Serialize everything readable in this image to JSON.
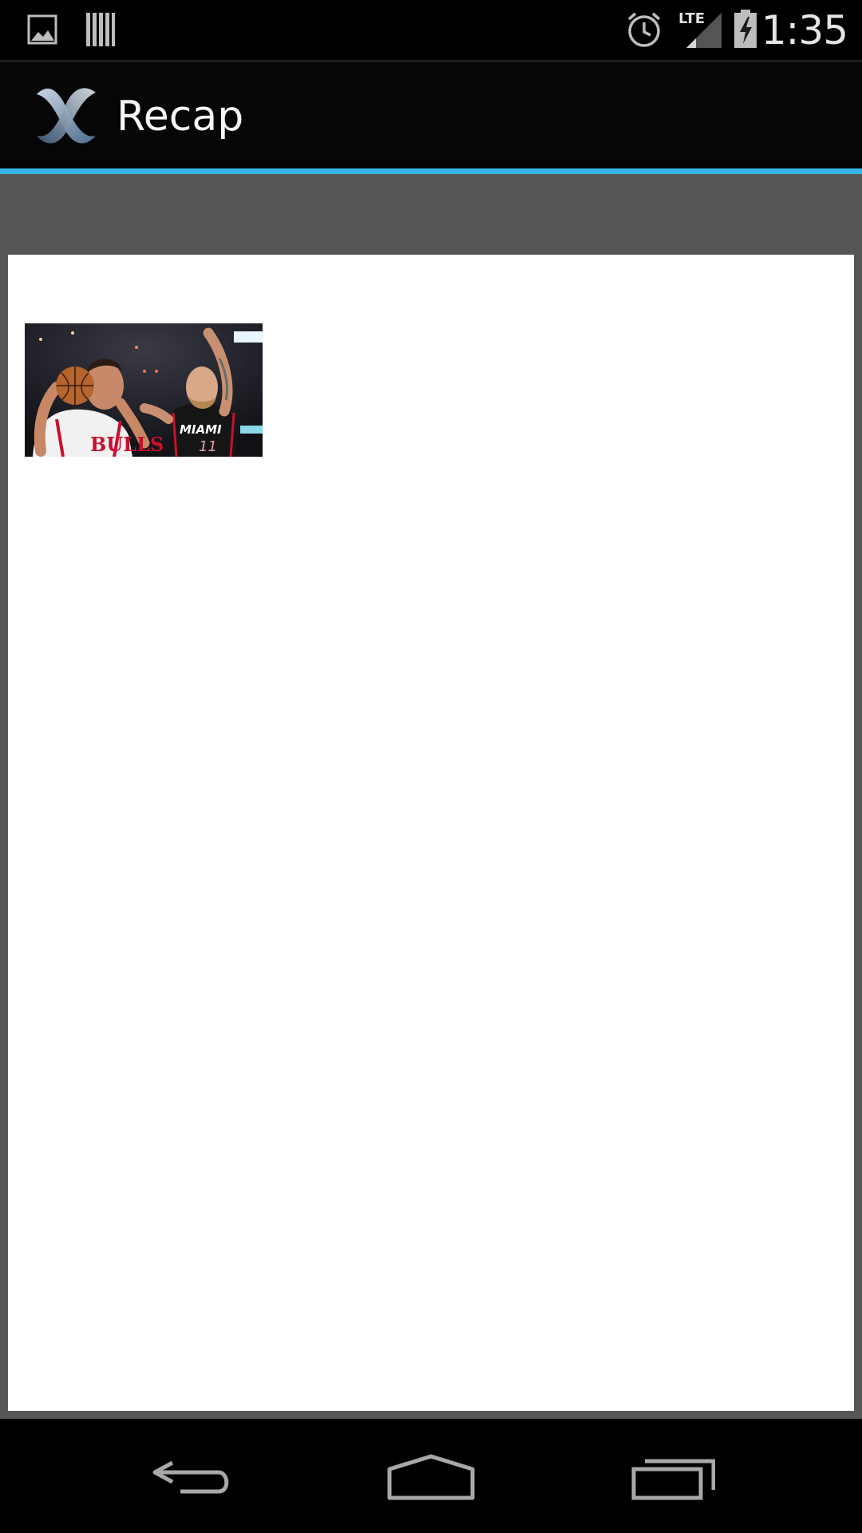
{
  "status_bar": {
    "time": "1:35",
    "network": "LTE",
    "icons": [
      "picture-notification-icon",
      "barcode-notification-icon",
      "alarm-icon",
      "lte-signal-icon",
      "battery-charging-icon"
    ]
  },
  "action_bar": {
    "title": "Recap",
    "accent_color": "#33b5e5"
  },
  "content": {
    "image": {
      "description_icon": "basketball-photo",
      "team_left": "BULLS",
      "team_right": "MIAMI",
      "jersey_number_right": "11"
    }
  },
  "navigation": {
    "buttons": [
      "back-icon",
      "home-icon",
      "recent-apps-icon"
    ]
  }
}
